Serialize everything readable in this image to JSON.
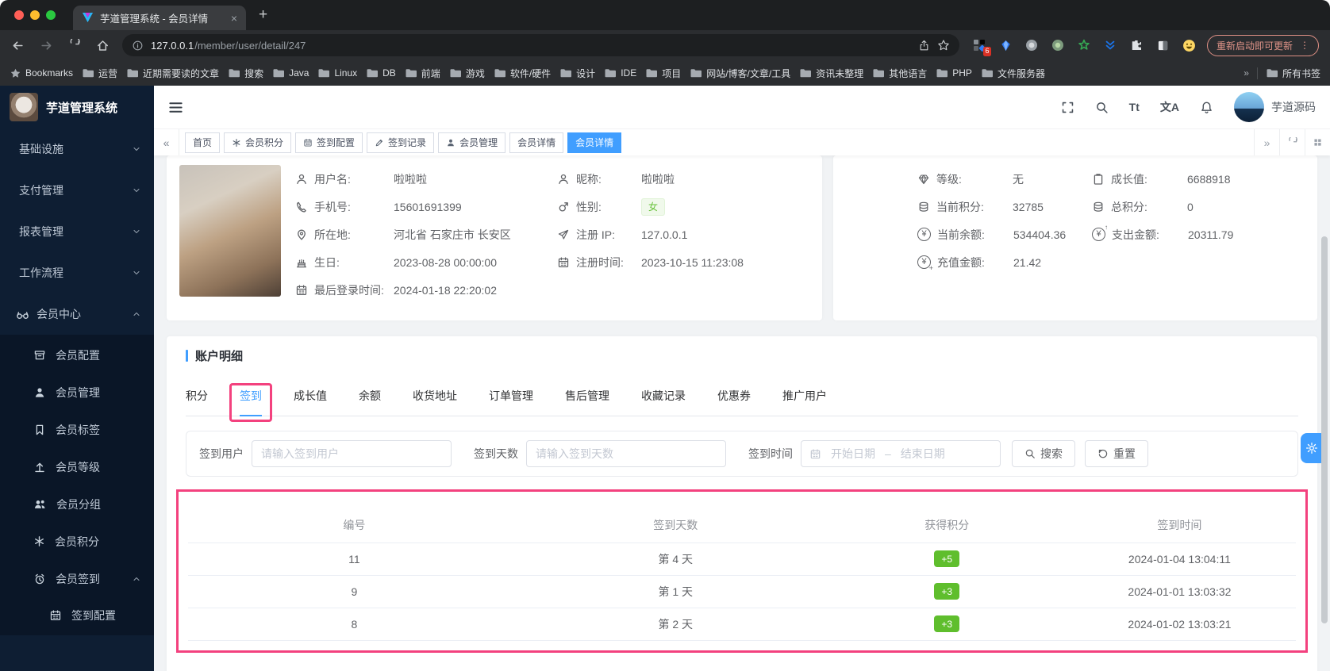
{
  "browser": {
    "tab_title": "芋道管理系统 - 会员详情",
    "url_host": "127.0.0.1",
    "url_path": "/member/user/detail/247",
    "update_button": "重新启动即可更新",
    "extension_badge": "6",
    "bookmarks_label": "Bookmarks",
    "bookmarks": [
      "运营",
      "近期需要读的文章",
      "搜索",
      "Java",
      "Linux",
      "DB",
      "前端",
      "游戏",
      "软件/硬件",
      "设计",
      "IDE",
      "项目",
      "网站/博客/文章/工具",
      "资讯未整理",
      "其他语言",
      "PHP",
      "文件服务器"
    ],
    "all_bookmarks": "所有书签"
  },
  "glyphs": {
    "close": "×",
    "plus": "+",
    "menu_dots": "⋮",
    "back_chevrons": "«",
    "forward_chevrons": "»",
    "font_size_icon": "Tt",
    "translate_icon": "文A",
    "range_separator": "–",
    "yen": "¥"
  },
  "sidebar": {
    "app_title": "芋道管理系统",
    "groups": [
      {
        "label": "基础设施"
      },
      {
        "label": "支付管理"
      },
      {
        "label": "报表管理"
      },
      {
        "label": "工作流程"
      }
    ],
    "member_center": "会员中心",
    "items": [
      {
        "label": "会员配置"
      },
      {
        "label": "会员管理"
      },
      {
        "label": "会员标签"
      },
      {
        "label": "会员等级"
      },
      {
        "label": "会员分组"
      },
      {
        "label": "会员积分"
      },
      {
        "label": "会员签到"
      }
    ],
    "sub_item": "签到配置"
  },
  "navbar": {
    "username": "芋道源码"
  },
  "tags": {
    "items": [
      {
        "label": "首页"
      },
      {
        "label": "会员积分"
      },
      {
        "label": "签到配置"
      },
      {
        "label": "签到记录"
      },
      {
        "label": "会员管理"
      },
      {
        "label": "会员详情"
      },
      {
        "label": "会员详情"
      }
    ]
  },
  "profile": {
    "fields_left": [
      {
        "label": "用户名:",
        "value": "啦啦啦"
      },
      {
        "label": "手机号:",
        "value": "15601691399"
      },
      {
        "label": "所在地:",
        "value": "河北省 石家庄市 长安区"
      },
      {
        "label": "生日:",
        "value": "2023-08-28 00:00:00"
      },
      {
        "label": "最后登录时间:",
        "value": "2024-01-18 22:20:02"
      }
    ],
    "fields_right": [
      {
        "label": "昵称:",
        "value": "啦啦啦"
      },
      {
        "label": "性别:",
        "value": "女"
      },
      {
        "label": "注册 IP:",
        "value": "127.0.0.1"
      },
      {
        "label": "注册时间:",
        "value": "2023-10-15 11:23:08"
      }
    ]
  },
  "stats": {
    "left": [
      {
        "label": "等级:",
        "value": "无"
      },
      {
        "label": "当前积分:",
        "value": "32785"
      },
      {
        "label": "当前余额:",
        "value": "534404.36"
      },
      {
        "label": "充值金额:",
        "value": "21.42"
      }
    ],
    "right": [
      {
        "label": "成长值:",
        "value": "6688918"
      },
      {
        "label": "总积分:",
        "value": "0"
      },
      {
        "label": "支出金额:",
        "value": "20311.79"
      }
    ]
  },
  "account": {
    "section_title": "账户明细",
    "tabs": [
      {
        "label": "积分"
      },
      {
        "label": "签到"
      },
      {
        "label": "成长值"
      },
      {
        "label": "余额"
      },
      {
        "label": "收货地址"
      },
      {
        "label": "订单管理"
      },
      {
        "label": "售后管理"
      },
      {
        "label": "收藏记录"
      },
      {
        "label": "优惠券"
      },
      {
        "label": "推广用户"
      }
    ],
    "active_tab": "签到",
    "filters": {
      "user_label": "签到用户",
      "user_placeholder": "请输入签到用户",
      "days_label": "签到天数",
      "days_placeholder": "请输入签到天数",
      "time_label": "签到时间",
      "start_placeholder": "开始日期",
      "end_placeholder": "结束日期",
      "search_button": "搜索",
      "reset_button": "重置"
    },
    "table": {
      "headers": [
        "编号",
        "签到天数",
        "获得积分",
        "签到时间"
      ],
      "rows": [
        {
          "id": "11",
          "day": "第 4 天",
          "points": "+5",
          "time": "2024-01-04 13:04:11"
        },
        {
          "id": "9",
          "day": "第 1 天",
          "points": "+3",
          "time": "2024-01-01 13:03:32"
        },
        {
          "id": "8",
          "day": "第 2 天",
          "points": "+3",
          "time": "2024-01-02 13:03:21"
        }
      ]
    }
  },
  "colors": {
    "primary": "#409eff",
    "success_badge": "#5fbe2d",
    "annotation_pink": "#f3417e",
    "sidebar_bg": "#0e1e33"
  }
}
